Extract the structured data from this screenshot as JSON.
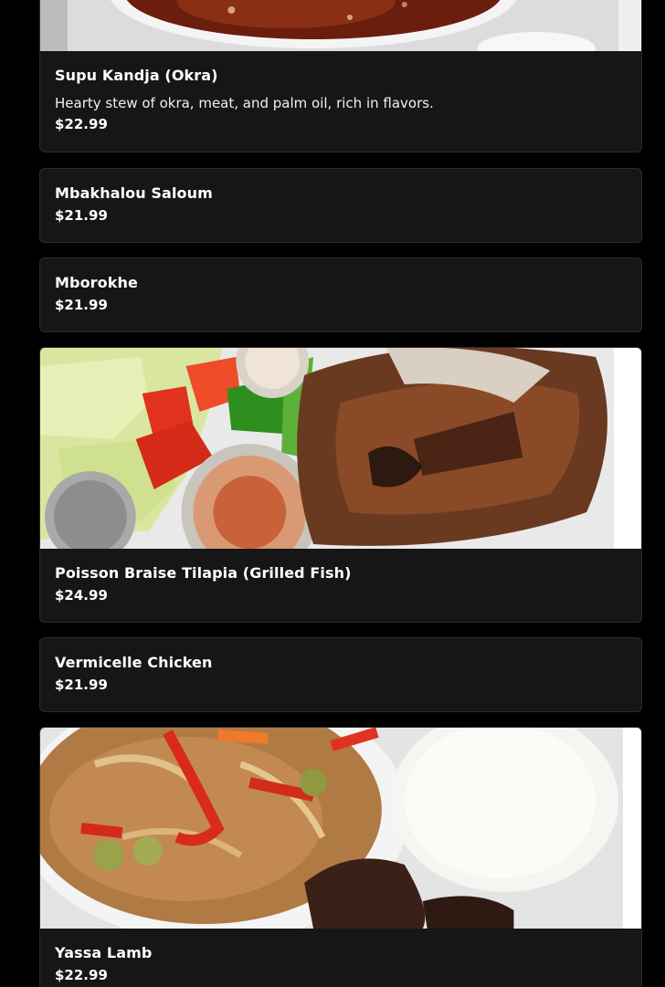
{
  "menu": {
    "items": [
      {
        "name": "Supu Kandja (Okra)",
        "description": "Hearty stew of okra, meat, and palm oil, rich in flavors.",
        "price": "$22.99",
        "image": "okra-stew-photo"
      },
      {
        "name": "Mbakhalou Saloum",
        "price": "$21.99"
      },
      {
        "name": "Mborokhe",
        "price": "$21.99"
      },
      {
        "name": "Poisson Braise Tilapia (Grilled Fish)",
        "price": "$24.99",
        "image": "grilled-tilapia-photo"
      },
      {
        "name": "Vermicelle Chicken",
        "price": "$21.99"
      },
      {
        "name": "Yassa Lamb",
        "price": "$22.99",
        "image": "yassa-lamb-photo"
      }
    ]
  },
  "colors": {
    "background": "#000000",
    "card": "#161616",
    "text": "#ffffff"
  }
}
